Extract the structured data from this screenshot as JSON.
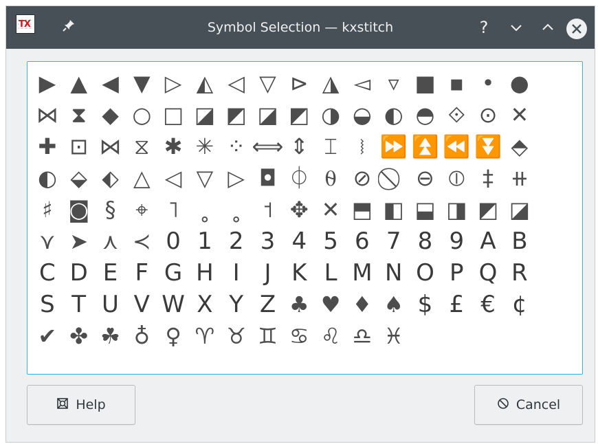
{
  "titlebar": {
    "title": "Symbol Selection — kxstitch",
    "app_icon_text": "TX",
    "pin_icon": "pin-icon",
    "help_glyph": "?",
    "min_glyph": "⌄",
    "max_glyph": "⌃",
    "close_glyph": "✕"
  },
  "symbols": [
    "▶",
    "▲",
    "◀",
    "▼",
    "▷",
    "◭",
    "◁",
    "▽",
    "⊳",
    "◮",
    "◅",
    "▿",
    "■",
    "▪",
    "•",
    "●",
    "⋈",
    "⧗",
    "◆",
    "○",
    "□",
    "◪",
    "◩",
    "◪",
    "◩",
    "◑",
    "◒",
    "◐",
    "◓",
    "⟐",
    "⊙",
    "✕",
    "✚",
    "⊡",
    "⋈",
    "⧖",
    "✱",
    "✳",
    "⁘",
    "⟺",
    "⇕",
    "⌶",
    "⧘",
    "⏩",
    "⏫",
    "⏪",
    "⏬",
    "⬘",
    "◐",
    "⬙",
    "⬖",
    "△",
    "◁",
    "▽",
    "▷",
    "◘",
    "⏀",
    "⍬",
    "⊘",
    "⃠",
    "⊖",
    "⦶",
    "‡",
    "⧺",
    "♯",
    "◙",
    "§",
    "⌖",
    "˥",
    "˳",
    "˳",
    "˦",
    "✥",
    "✕",
    "⬒",
    "◧",
    "⬓",
    "◨",
    "◩",
    "◪",
    "⋎",
    "➤",
    "⋏",
    "≺",
    "0",
    "1",
    "2",
    "3",
    "4",
    "5",
    "6",
    "7",
    "8",
    "9",
    "A",
    "B",
    "C",
    "D",
    "E",
    "F",
    "G",
    "H",
    "I",
    "J",
    "K",
    "L",
    "M",
    "N",
    "O",
    "P",
    "Q",
    "R",
    "S",
    "T",
    "U",
    "V",
    "W",
    "X",
    "Y",
    "Z",
    "♣",
    "♥",
    "♦",
    "♠",
    "$",
    "£",
    "€",
    "¢",
    "✔",
    "✤",
    "☘",
    "♁",
    "♀",
    "♈",
    "♉",
    "♊",
    "♋",
    "♌",
    "♎",
    "♓"
  ],
  "buttons": {
    "help_label": "Help",
    "help_icon": "lifebuoy-icon",
    "cancel_label": "Cancel",
    "cancel_icon": "cancel-icon"
  },
  "colors": {
    "titlebar": "#475057",
    "focus_border": "#3daee9",
    "window_bg": "#eff0f1",
    "symbol_color": "#4d4d4d"
  }
}
